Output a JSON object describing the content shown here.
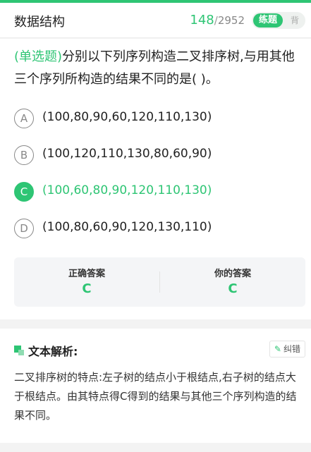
{
  "header": {
    "title": "数据结构",
    "current": "148",
    "separator": "/",
    "total": "2952",
    "mode_active": "练题",
    "mode_inactive": "背"
  },
  "question": {
    "type_label": "(单选题)",
    "text": "分别以下列序列构造二叉排序树,与用其他三个序列所构造的结果不同的是(        )。"
  },
  "options": [
    {
      "letter": "A",
      "text": "(100,80,90,60,120,110,130)",
      "selected": false
    },
    {
      "letter": "B",
      "text": "(100,120,110,130,80,60,90)",
      "selected": false
    },
    {
      "letter": "C",
      "text": "(100,60,80,90,120,110,130)",
      "selected": true
    },
    {
      "letter": "D",
      "text": "(100,80,60,90,120,130,110)",
      "selected": false
    }
  ],
  "answers": {
    "correct_label": "正确答案",
    "correct_value": "C",
    "yours_label": "你的答案",
    "yours_value": "C"
  },
  "analysis": {
    "title": "文本解析:",
    "correct_button": "纠错",
    "text": "二叉排序树的特点:左子树的结点小于根结点,右子树的结点大于根结点。由其特点得C得到的结果与其他三个序列构造的结果不同。"
  },
  "colors": {
    "accent": "#2ec574"
  },
  "icons": {
    "analysis": "squares-icon",
    "correct": "pen-edit-icon"
  }
}
